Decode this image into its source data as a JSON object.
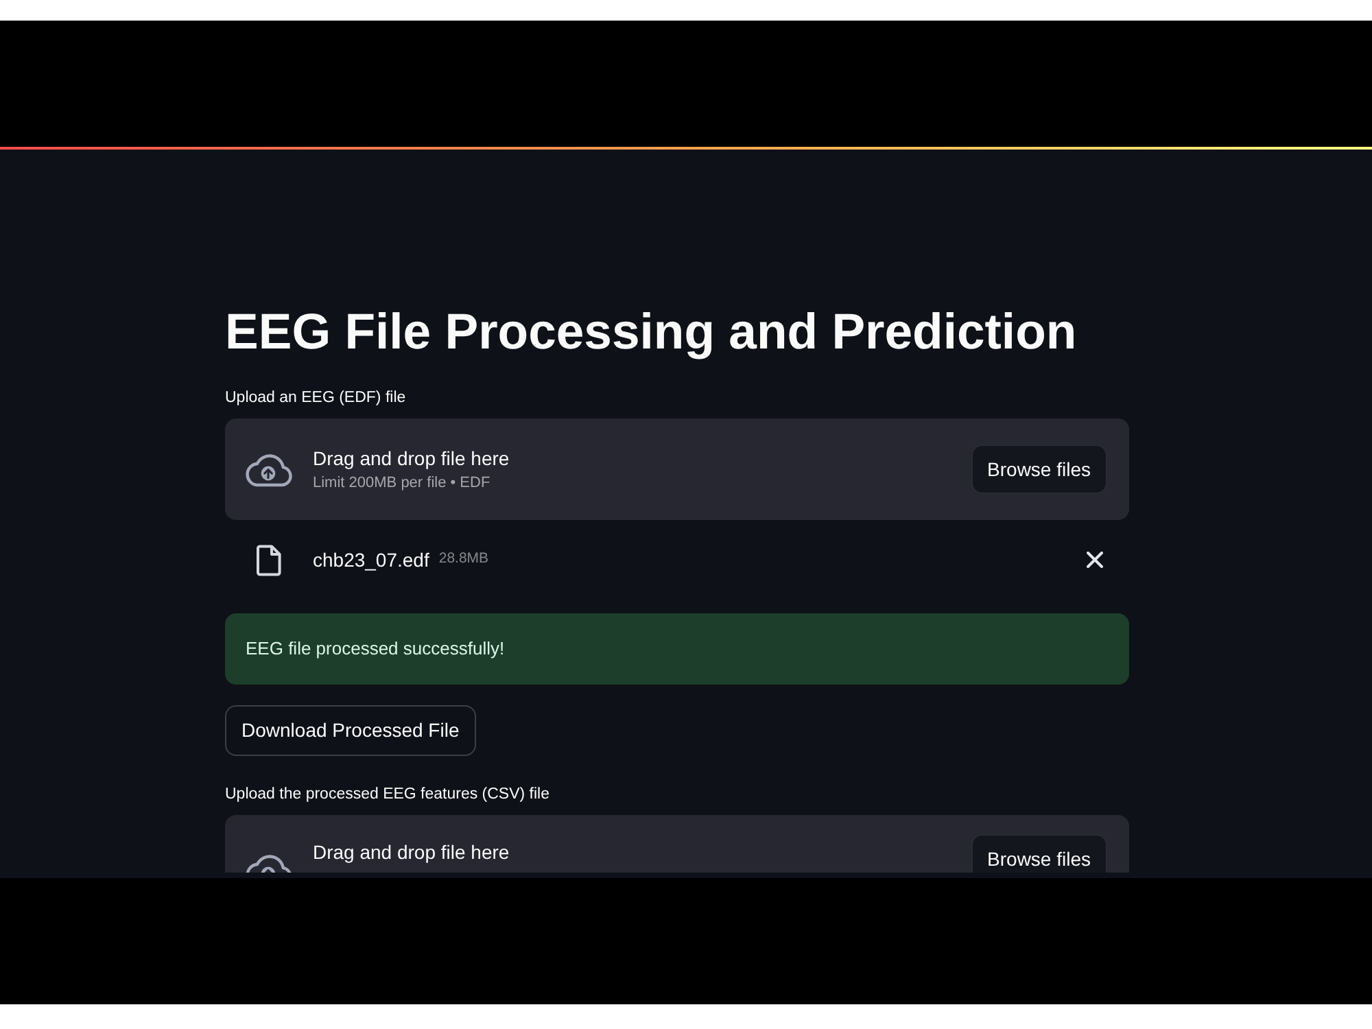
{
  "title": "EEG File Processing and Prediction",
  "blocks": [
    {
      "kind": "file_uploader",
      "label": "Upload an EEG (EDF) file",
      "dropzone_text": "Drag and drop file here",
      "limit_text": "Limit 200MB per file • EDF",
      "button": "Browse files",
      "files": [
        {
          "name": "chb23_07.edf",
          "size": "28.8MB"
        }
      ]
    },
    {
      "kind": "success_alert",
      "text": "EEG file processed successfully!"
    },
    {
      "kind": "download_button",
      "label": "Download Processed File"
    },
    {
      "kind": "file_uploader",
      "label": "Upload the processed EEG features (CSV) file",
      "dropzone_text": "Drag and drop file here",
      "button": "Browse files"
    }
  ]
}
